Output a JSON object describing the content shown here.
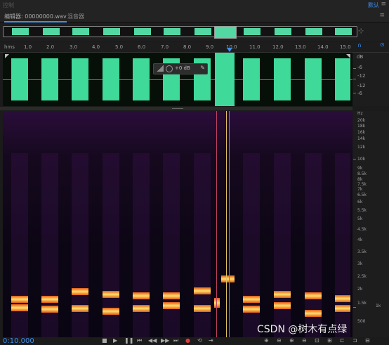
{
  "topbar": {
    "left_text": "控制",
    "workspace": "默认",
    "menu_icon": "menu-icon"
  },
  "tabs": [
    {
      "label": "编辑器: 00000000.wav",
      "close": "≡"
    },
    {
      "label": "混音器"
    }
  ],
  "ruler": {
    "unit": "hms",
    "ticks": [
      "1.0",
      "2.0",
      "3.0",
      "4.0",
      "5.0",
      "6.0",
      "7.0",
      "8.0",
      "9.0",
      "10.0",
      "11.0",
      "12.0",
      "13.0",
      "14.0",
      "15.0"
    ]
  },
  "hud": {
    "gain": "+0 dB"
  },
  "db_scale": {
    "unit": "dB",
    "labels": [
      "-6",
      "-12",
      "-12",
      "-6"
    ]
  },
  "hz_scale": {
    "unit": "Hz",
    "labels": [
      "20k",
      "18k",
      "16k",
      "14k",
      "12k",
      "10k",
      "9k",
      "8.5k",
      "8k",
      "7.5k",
      "7k",
      "6.5k",
      "6k",
      "5.5k",
      "5k",
      "4.5k",
      "4k",
      "3.5k",
      "3k",
      "2.5k",
      "2k",
      "1.5k",
      "1k",
      "500"
    ]
  },
  "transport": {
    "time": "0:10.000",
    "buttons": [
      "stop-icon",
      "play-icon",
      "pause-icon",
      "skip-start-icon",
      "rewind-icon",
      "fast-forward-icon",
      "skip-end-icon",
      "record-icon",
      "loop-icon",
      "skip-selection-icon"
    ]
  },
  "watermark": "CSDN @树木有点绿",
  "colors": {
    "waveform": "#3fd99a",
    "accent": "#3d8ff0",
    "playhead": "#e0c060"
  }
}
